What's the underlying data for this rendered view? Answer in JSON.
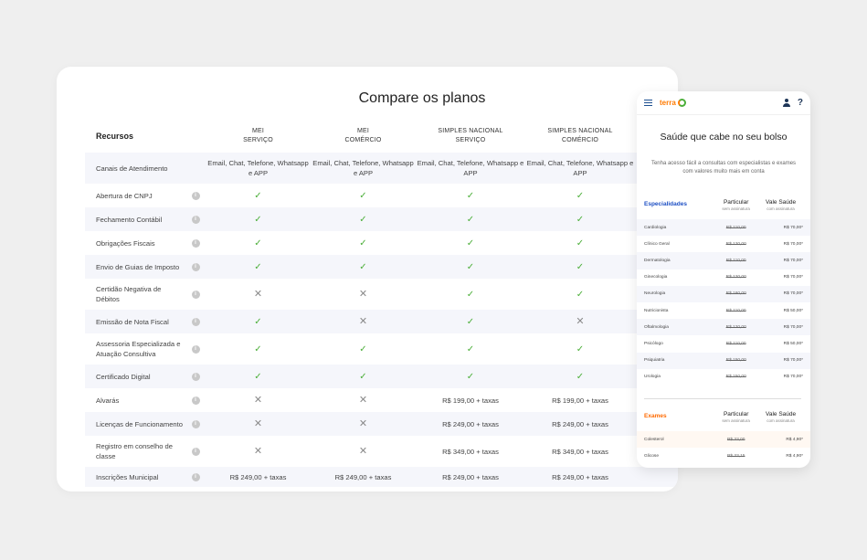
{
  "desktop": {
    "title": "Compare os planos",
    "feature_header": "Recursos",
    "plans": [
      {
        "line1": "MEI",
        "line2": "SERVIÇO"
      },
      {
        "line1": "MEI",
        "line2": "COMÉRCIO"
      },
      {
        "line1": "SIMPLES NACIONAL",
        "line2": "SERVIÇO"
      },
      {
        "line1": "SIMPLES NACIONAL",
        "line2": "COMÉRCIO"
      }
    ],
    "rows": [
      {
        "feature": "Canais de Atendimento",
        "info": false,
        "values": [
          "Email, Chat, Telefone, Whatsapp e APP",
          "Email, Chat, Telefone, Whatsapp e APP",
          "Email, Chat, Telefone, Whatsapp e APP",
          "Email, Chat, Telefone, Whatsapp e APP"
        ]
      },
      {
        "feature": "Abertura de CNPJ",
        "info": true,
        "values": [
          "check",
          "check",
          "check",
          "check"
        ]
      },
      {
        "feature": "Fechamento Contábil",
        "info": true,
        "values": [
          "check",
          "check",
          "check",
          "check"
        ]
      },
      {
        "feature": "Obrigações Fiscais",
        "info": true,
        "values": [
          "check",
          "check",
          "check",
          "check"
        ]
      },
      {
        "feature": "Envio de Guias de Imposto",
        "info": true,
        "values": [
          "check",
          "check",
          "check",
          "check"
        ]
      },
      {
        "feature": "Certidão Negativa de Débitos",
        "info": true,
        "values": [
          "cross",
          "cross",
          "check",
          "check"
        ]
      },
      {
        "feature": "Emissão de Nota Fiscal",
        "info": true,
        "values": [
          "check",
          "cross",
          "check",
          "cross"
        ]
      },
      {
        "feature": "Assessoria Especializada e Atuação Consultiva",
        "info": true,
        "values": [
          "check",
          "check",
          "check",
          "check"
        ]
      },
      {
        "feature": "Certificado Digital",
        "info": true,
        "values": [
          "check",
          "check",
          "check",
          "check"
        ]
      },
      {
        "feature": "Alvarás",
        "info": true,
        "values": [
          "cross",
          "cross",
          "R$ 199,00 + taxas",
          "R$ 199,00 + taxas"
        ]
      },
      {
        "feature": "Licenças de Funcionamento",
        "info": true,
        "values": [
          "cross",
          "cross",
          "R$ 249,00 + taxas",
          "R$ 249,00 + taxas"
        ]
      },
      {
        "feature": "Registro em conselho de classe",
        "info": true,
        "values": [
          "cross",
          "cross",
          "R$ 349,00 + taxas",
          "R$ 349,00 + taxas"
        ]
      },
      {
        "feature": "Inscrições Municipal",
        "info": true,
        "values": [
          "R$ 249,00 + taxas",
          "R$ 249,00 + taxas",
          "R$ 249,00 + taxas",
          "R$ 249,00 + taxas"
        ]
      }
    ],
    "info_glyph": "i",
    "check_glyph": "✓",
    "cross_glyph": "✕"
  },
  "mobile": {
    "brand": "terra",
    "help": "?",
    "title": "Saúde que cabe no seu bolso",
    "subtitle": "Tenha acesso fácil a consultas com especialistas e exames com valores muito mais em conta",
    "specialties": {
      "heading": "Especialidades",
      "heading_color": "#1d4fc4",
      "col1": "Particular",
      "col1_sub": "sem assinatura",
      "col2": "Vale Saúde",
      "col2_sub": "com assinatura",
      "rows": [
        {
          "name": "Cardiologia",
          "old": "R$ 110,00",
          "price": "R$ 70,00*"
        },
        {
          "name": "Clínico Geral",
          "old": "R$ 120,00",
          "price": "R$ 70,00*"
        },
        {
          "name": "Dermatologia",
          "old": "R$ 110,00",
          "price": "R$ 70,00*"
        },
        {
          "name": "Ginecologia",
          "old": "R$ 120,00",
          "price": "R$ 70,00*"
        },
        {
          "name": "Neurologia",
          "old": "R$ 160,00",
          "price": "R$ 70,00*"
        },
        {
          "name": "Nutricionista",
          "old": "R$ 110,00",
          "price": "R$ 50,00*"
        },
        {
          "name": "Oftalmologia",
          "old": "R$ 120,00",
          "price": "R$ 70,00*"
        },
        {
          "name": "Psicólogo",
          "old": "R$ 110,00",
          "price": "R$ 50,00*"
        },
        {
          "name": "Psiquiatria",
          "old": "R$ 150,00",
          "price": "R$ 70,00*"
        },
        {
          "name": "Urologia",
          "old": "R$ 150,00",
          "price": "R$ 70,00*"
        }
      ]
    },
    "exams": {
      "heading": "Exames",
      "heading_color": "#ff6a00",
      "col1": "Particular",
      "col1_sub": "sem assinatura",
      "col2": "Vale Saúde",
      "col2_sub": "com assinatura",
      "rows": [
        {
          "name": "Colesterol",
          "old": "R$ 33,00",
          "price": "R$ 4,90*"
        },
        {
          "name": "Glicose",
          "old": "R$ 33,15",
          "price": "R$ 4,90*"
        }
      ]
    }
  }
}
